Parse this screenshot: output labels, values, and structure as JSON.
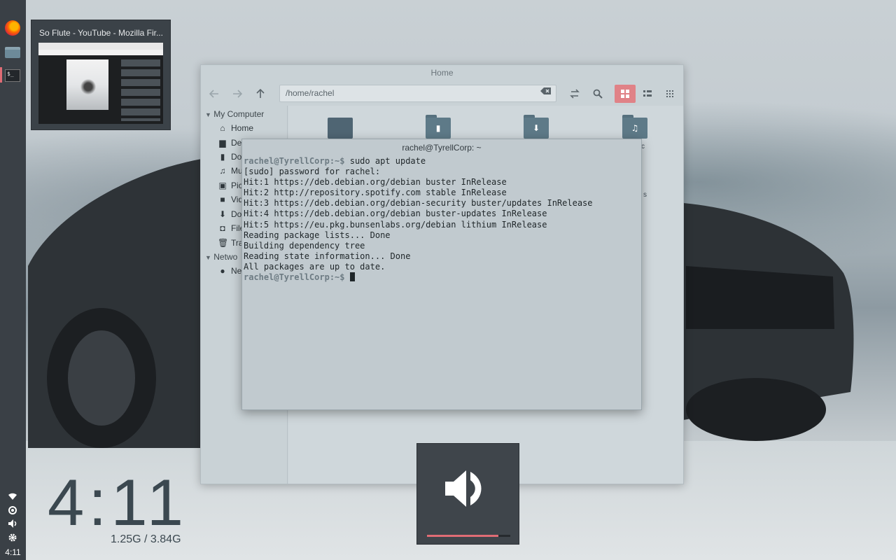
{
  "preview": {
    "title": "So Flute - YouTube - Mozilla Fir..."
  },
  "file_manager": {
    "title": "Home",
    "path": "/home/rachel",
    "sidebar": {
      "my_computer": "My Computer",
      "network_header": "Netwo",
      "items": [
        {
          "icon": "home-icon",
          "label": "Home"
        },
        {
          "icon": "desktop-icon",
          "label": "Des"
        },
        {
          "icon": "document-icon",
          "label": "Do"
        },
        {
          "icon": "music-icon",
          "label": "Mu"
        },
        {
          "icon": "picture-icon",
          "label": "Pic"
        },
        {
          "icon": "video-icon",
          "label": "Vid"
        },
        {
          "icon": "download-icon",
          "label": "Do"
        },
        {
          "icon": "filesystem-icon",
          "label": "File"
        },
        {
          "icon": "trash-icon",
          "label": "Tra"
        }
      ],
      "network_item": "Ne"
    },
    "folder_peeks": {
      "music": "c",
      "videos": "s"
    }
  },
  "terminal": {
    "title": "rachel@TyrellCorp: ~",
    "prompt": "rachel@TyrellCorp:~$",
    "command": " sudo apt update",
    "output": [
      "[sudo] password for rachel:",
      "Hit:1 https://deb.debian.org/debian buster InRelease",
      "Hit:2 http://repository.spotify.com stable InRelease",
      "Hit:3 https://deb.debian.org/debian-security buster/updates InRelease",
      "Hit:4 https://deb.debian.org/debian buster-updates InRelease",
      "Hit:5 https://eu.pkg.bunsenlabs.org/debian lithium InRelease",
      "Reading package lists... Done",
      "Building dependency tree",
      "Reading state information... Done",
      "All packages are up to date."
    ],
    "final_prompt": "rachel@TyrellCorp:~$"
  },
  "panel": {
    "clock": "4:11"
  },
  "desktop": {
    "clock": "4:11",
    "memory": "1.25G / 3.84G"
  },
  "volume": {
    "level": 0.86,
    "accent": "#e06c75"
  }
}
